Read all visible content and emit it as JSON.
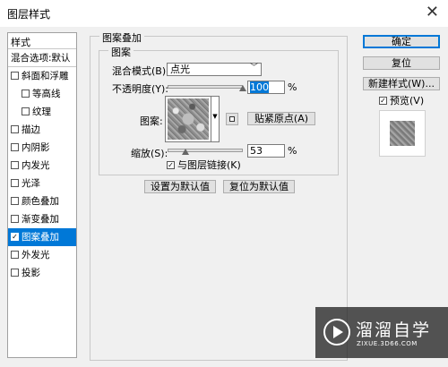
{
  "window": {
    "title": "图层样式",
    "close_glyph": "✕"
  },
  "sidebar": {
    "header": "样式",
    "blend_options": "混合选项:默认",
    "items": [
      {
        "label": "斜面和浮雕",
        "checked": false
      },
      {
        "label": "等高线",
        "checked": false
      },
      {
        "label": "纹理",
        "checked": false
      },
      {
        "label": "描边",
        "checked": false
      },
      {
        "label": "内阴影",
        "checked": false
      },
      {
        "label": "内发光",
        "checked": false
      },
      {
        "label": "光泽",
        "checked": false
      },
      {
        "label": "颜色叠加",
        "checked": false
      },
      {
        "label": "渐变叠加",
        "checked": false
      },
      {
        "label": "图案叠加",
        "checked": true,
        "selected": true
      },
      {
        "label": "外发光",
        "checked": false
      },
      {
        "label": "投影",
        "checked": false
      }
    ]
  },
  "panel": {
    "group_title": "图案叠加",
    "subgroup_title": "图案",
    "blend_mode_label": "混合模式(B):",
    "blend_mode_value": "点光",
    "opacity_label": "不透明度(Y):",
    "opacity_value": "100",
    "opacity_unit": "%",
    "opacity_level": 100,
    "pattern_label": "图案:",
    "snap_origin_button": "贴紧原点(A)",
    "scale_label": "缩放(S):",
    "scale_value": "53",
    "scale_unit": "%",
    "scale_level": 53,
    "link_label": "与图层链接(K)",
    "link_checked": true,
    "set_default_button": "设置为默认值",
    "reset_default_button": "复位为默认值"
  },
  "actions": {
    "ok": "确定",
    "reset": "复位",
    "new_style": "新建样式(W)...",
    "preview_label": "预览(V)",
    "preview_checked": true
  },
  "watermark": {
    "title": "溜溜自学",
    "subtitle": "ZIXUE.3D66.COM"
  },
  "icons": {
    "close": "close-icon",
    "dropdown": "chevron-down-icon",
    "new_preset": "new-preset-icon",
    "logo": "play-logo-icon"
  }
}
